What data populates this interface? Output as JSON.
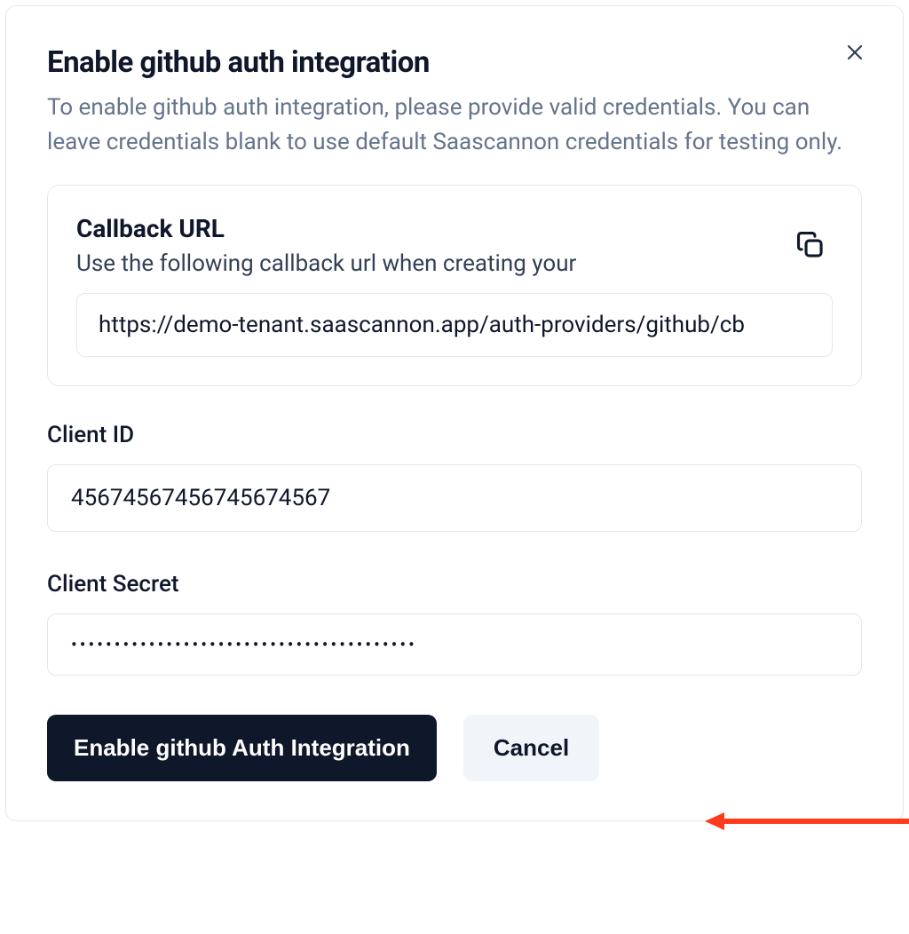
{
  "modal": {
    "title": "Enable github auth integration",
    "description": "To enable github auth integration, please provide valid credentials. You can leave credentials blank to use default Saascannon credentials for testing only."
  },
  "callback": {
    "title": "Callback URL",
    "subtitle": "Use the following callback url when creating your",
    "url": "https://demo-tenant.saascannon.app/auth-providers/github/cb"
  },
  "form": {
    "client_id_label": "Client ID",
    "client_id_value": "45674567456745674567",
    "client_secret_label": "Client Secret",
    "client_secret_value": "••••••••••••••••••••••••••••••••••••••••"
  },
  "buttons": {
    "submit": "Enable github Auth Integration",
    "cancel": "Cancel"
  }
}
